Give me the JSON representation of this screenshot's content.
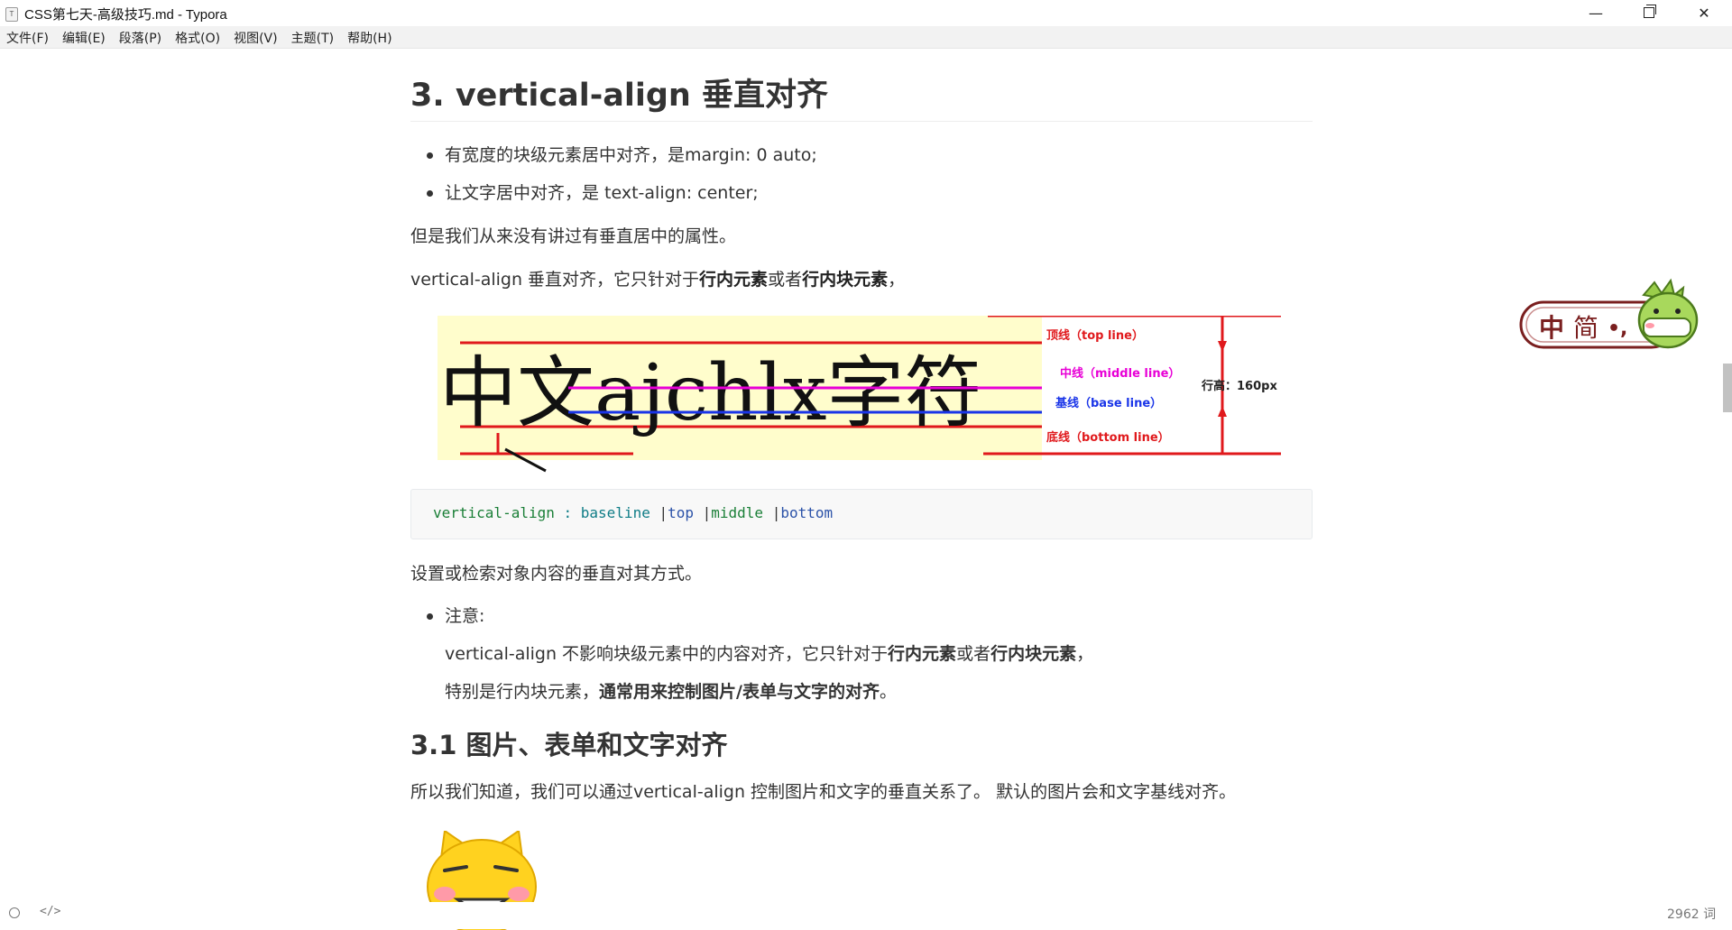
{
  "window": {
    "title": "CSS第七天-高级技巧.md - Typora",
    "app_icon": "T",
    "minimize": "—",
    "close": "✕"
  },
  "menu": [
    "文件(F)",
    "编辑(E)",
    "段落(P)",
    "格式(O)",
    "视图(V)",
    "主题(T)",
    "帮助(H)"
  ],
  "doc": {
    "heading": "3. vertical-align 垂直对齐",
    "bullets": [
      "有宽度的块级元素居中对齐，是margin: 0 auto;",
      "让文字居中对齐，是 text-align: center;"
    ],
    "para1": "但是我们从来没有讲过有垂直居中的属性。",
    "para2": {
      "a": "vertical-align 垂直对齐，它只针对于",
      "b1": "行内元素",
      "c": "或者",
      "b2": "行内块元素",
      "d": "，"
    },
    "diagram": {
      "big_text": "中文ajchlx字符",
      "labels": {
        "top": "顶线（top line）",
        "middle": "中线（middle line）",
        "base": "基线（base line）",
        "bottom": "底线（bottom line）",
        "height": "行高：160px"
      }
    },
    "code": {
      "prop": "vertical-align",
      "sep": " : ",
      "v1": "baseline",
      "v2": "top",
      "v3": "middle",
      "v4": "bottom",
      "bar": " |"
    },
    "para3": "设置或检索对象内容的垂直对其方式。",
    "note": {
      "label": "注意:",
      "line1": {
        "a": "vertical-align 不影响块级元素中的内容对齐，它只针对于",
        "b1": "行内元素",
        "c": "或者",
        "b2": "行内块元素",
        "d": "，"
      },
      "line2": {
        "a": "特别是行内块元素，",
        "b": "通常用来控制图片/表单与文字的对齐",
        "c": "。"
      }
    },
    "subheading": "3.1 图片、表单和文字对齐",
    "para4": "所以我们知道，我们可以通过vertical-align 控制图片和文字的垂直关系了。 默认的图片会和文字基线对齐。"
  },
  "ime": {
    "text1": "中",
    "text2": "简",
    "dots": "•,"
  },
  "status": {
    "code_icon": "</>",
    "word_count": "2962 词"
  },
  "colors": {
    "red": "#e0191c",
    "magenta": "#e800d6",
    "blue": "#1a35e8",
    "diagram_bg": "#fffdcc"
  }
}
